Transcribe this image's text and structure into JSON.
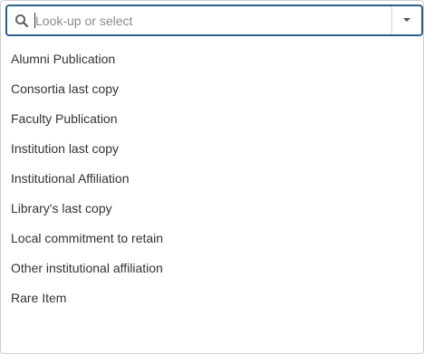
{
  "search": {
    "placeholder": "Look-up or select",
    "value": "",
    "icon": "search-icon"
  },
  "dropdown": {
    "icon": "chevron-down-icon"
  },
  "options": [
    "Alumni Publication",
    "Consortia last copy",
    "Faculty Publication",
    "Institution last copy",
    "Institutional Affiliation",
    "Library's last copy",
    "Local commitment to retain",
    "Other institutional affiliation",
    "Rare Item"
  ],
  "colors": {
    "focus_border": "#2a5f8a",
    "text": "#333333",
    "placeholder": "#8a8a8a"
  }
}
